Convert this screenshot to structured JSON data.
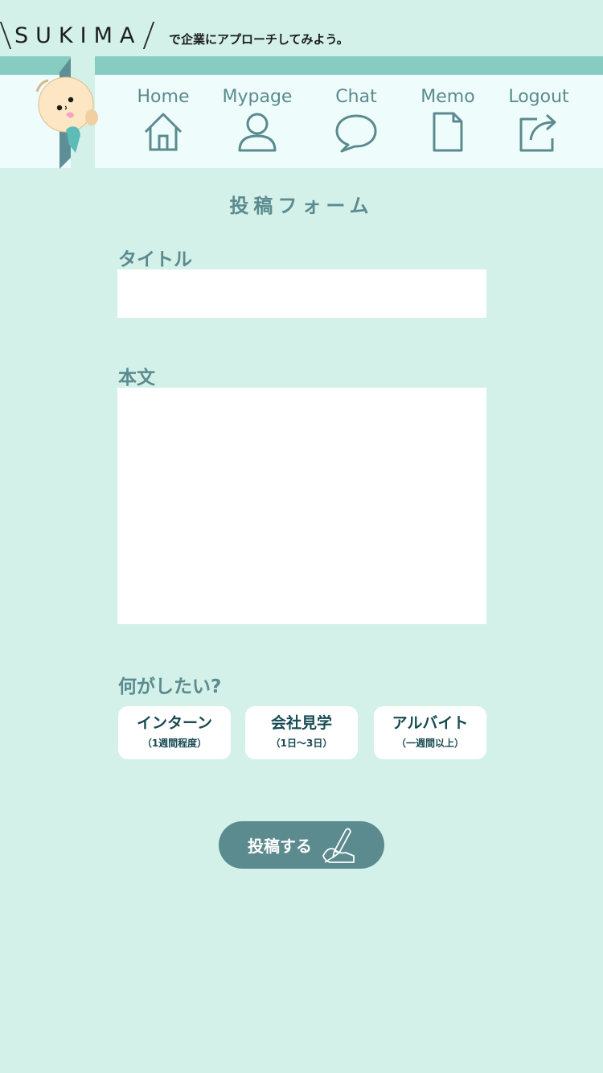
{
  "header": {
    "logo": "SUKIMA",
    "tagline": "で企業にアプローチしてみよう。"
  },
  "nav": {
    "items": [
      {
        "label": "Home",
        "icon": "home-icon"
      },
      {
        "label": "Mypage",
        "icon": "user-icon"
      },
      {
        "label": "Chat",
        "icon": "chat-bubble-icon"
      },
      {
        "label": "Memo",
        "icon": "document-icon"
      },
      {
        "label": "Logout",
        "icon": "logout-icon"
      }
    ]
  },
  "form": {
    "title": "投稿フォーム",
    "title_label": "タイトル",
    "title_value": "",
    "body_label": "本文",
    "body_value": "",
    "purpose_label": "何がしたい?",
    "options": [
      {
        "label": "インターン",
        "sub": "（1週間程度）"
      },
      {
        "label": "会社見学",
        "sub": "（1日〜3日）"
      },
      {
        "label": "アルバイト",
        "sub": "（一週間以上）"
      }
    ],
    "submit_label": "投稿する",
    "submit_icon": "pen-writing-icon"
  },
  "colors": {
    "background": "#d3f1e9",
    "accent": "#5b8a8f",
    "stripe": "#87ccc0",
    "navbar": "#eefdfb",
    "option_text": "#174b52"
  }
}
